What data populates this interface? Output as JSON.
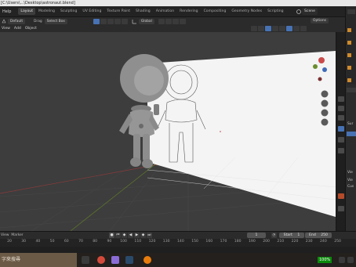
{
  "window": {
    "title": "[C:\\Users\\...\\Desktop\\astronaut.blend]"
  },
  "topbar": {
    "menu": [
      "Help"
    ],
    "tabs": [
      "Layout",
      "Modeling",
      "Sculpting",
      "UV Editing",
      "Texture Paint",
      "Shading",
      "Animation",
      "Rendering",
      "Compositing",
      "Geometry Nodes",
      "Scripting"
    ],
    "active_tab": "Layout",
    "scene_label": "Scene"
  },
  "tool_header": {
    "orientation_label": "Default",
    "drag_label": "Drag",
    "drag_value": "Select Box",
    "transform_orientation": "Global",
    "options_label": "Options"
  },
  "view_header": {
    "menu": [
      "View",
      "Add",
      "Object"
    ]
  },
  "timeline": {
    "menu": [
      "View",
      "Marker"
    ],
    "current_frame": "1",
    "start_label": "Start",
    "start_value": "1",
    "end_label": "End",
    "end_value": "250",
    "ruler_ticks": [
      "20",
      "30",
      "40",
      "50",
      "60",
      "70",
      "80",
      "90",
      "100",
      "110",
      "120",
      "130",
      "140",
      "150",
      "160",
      "170",
      "180",
      "190",
      "200",
      "210",
      "220",
      "230",
      "240",
      "250"
    ]
  },
  "properties_panel": {
    "rows": [
      "Sur",
      "Vie",
      "Vie",
      "Cus"
    ]
  },
  "taskbar": {
    "search_placeholder": "字來搜尋",
    "battery": "100%"
  },
  "colors": {
    "accent": "#4772b3",
    "viewport_bg": "#3d3d3d",
    "active_tab": "#3d3d3d",
    "taskbar_search": "#6b5a46"
  }
}
